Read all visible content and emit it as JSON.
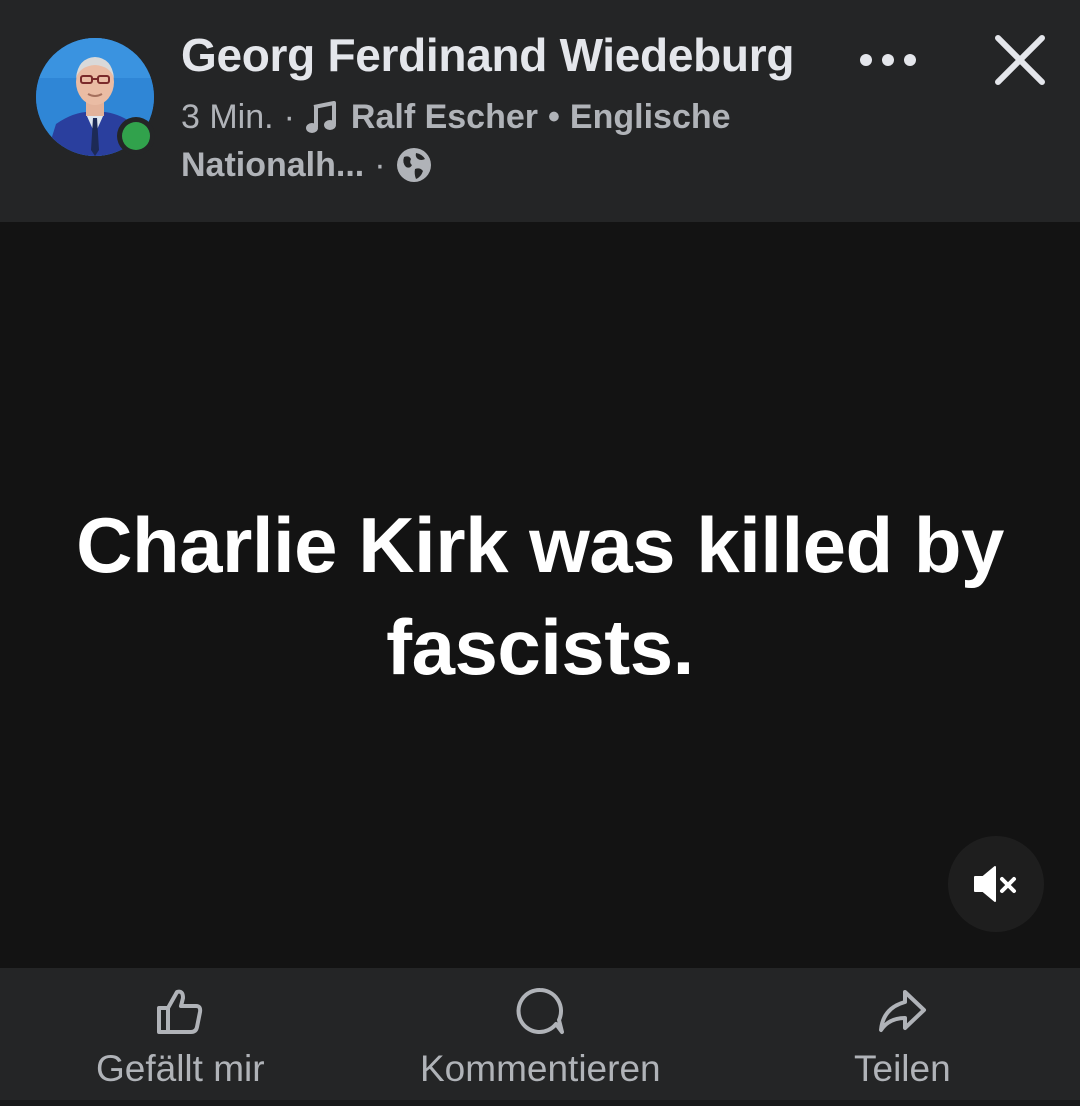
{
  "post": {
    "author": "Georg Ferdinand Wiedeburg",
    "time": "3 Min.",
    "dot_separator": "·",
    "music_artist": "Ralf Escher",
    "bullet": "•",
    "music_title_line1": "Englische",
    "music_title_line2": "Nationalh...",
    "audience_icon": "globe-icon",
    "online": true
  },
  "video": {
    "caption": "Charlie Kirk was killed by fascists.",
    "muted": true,
    "mute_icon": "speaker-muted-icon"
  },
  "actions": {
    "like_label": "Gefällt mir",
    "comment_label": "Kommentieren",
    "share_label": "Teilen"
  },
  "colors": {
    "background": "#242526",
    "video_background": "#131313",
    "primary_text": "#e4e6eb",
    "secondary_text": "#b0b3b8",
    "online_green": "#31a24c"
  }
}
